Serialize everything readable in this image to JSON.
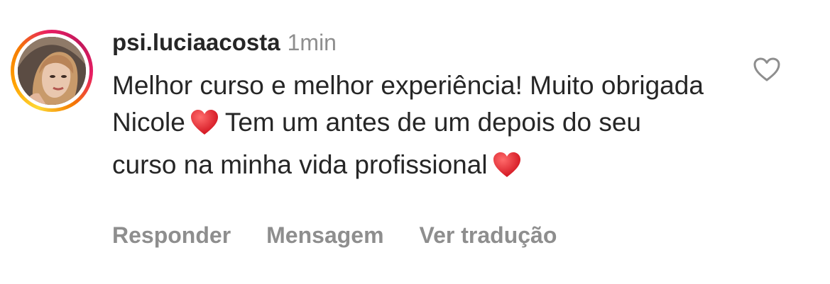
{
  "comment": {
    "username": "psi.luciaacosta",
    "timestamp": "1min",
    "text_parts": [
      "Melhor curso e melhor experiência! Muito obrigada Nicole",
      "Tem um antes de um depois do seu curso na minha vida profissional"
    ],
    "emoji": "red-heart",
    "actions": {
      "reply": "Responder",
      "message": "Mensagem",
      "translate": "Ver tradução"
    },
    "like_icon": "heart-outline-icon",
    "avatar_ring_colors": [
      "#fdd835",
      "#f57c00",
      "#e91e63",
      "#c2185b"
    ]
  }
}
